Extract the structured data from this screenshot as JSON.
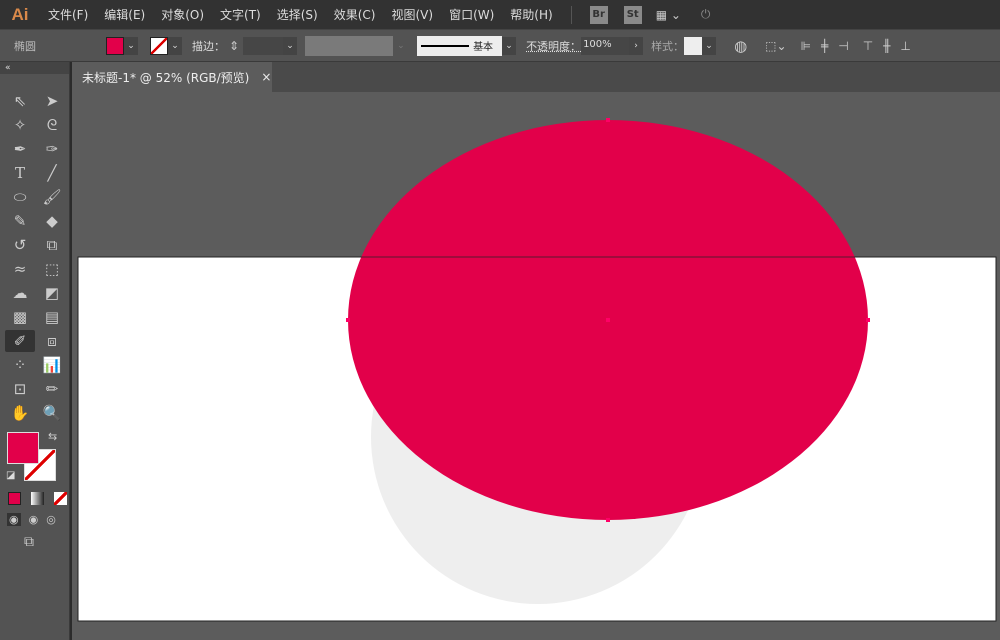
{
  "app": {
    "logo": "Ai"
  },
  "menu": [
    "文件(F)",
    "编辑(E)",
    "对象(O)",
    "文字(T)",
    "选择(S)",
    "效果(C)",
    "视图(V)",
    "窗口(W)",
    "帮助(H)"
  ],
  "menu_icons": {
    "bridge": "Br",
    "stock": "St"
  },
  "control": {
    "object_type": "椭圆",
    "stroke_label": "描边：",
    "stroke_style": "基本",
    "opacity_label": "不透明度：",
    "opacity_value": "100%",
    "style_label": "样式："
  },
  "tab": {
    "title": "未标题-1* @ 52% (RGB/预览)",
    "close": "×"
  },
  "colors": {
    "fill": "#e2004a",
    "secondary_shape": "#eeeeee",
    "artboard": "#ffffff",
    "pasteboard": "#5c5c5c"
  }
}
